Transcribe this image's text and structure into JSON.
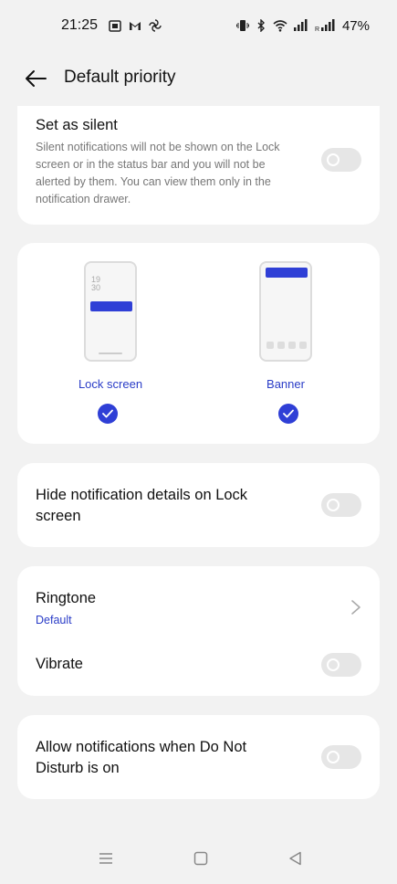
{
  "status_bar": {
    "time": "21:25",
    "battery": "47%",
    "left_icons": [
      "calendar-icon",
      "gmail-icon",
      "pinwheel-icon"
    ],
    "right_icons": [
      "vibrate-icon",
      "bluetooth-icon",
      "wifi-icon",
      "signal-icon",
      "signal-roaming-icon"
    ]
  },
  "header": {
    "title": "Default priority"
  },
  "silent": {
    "title": "Set as silent",
    "description": "Silent notifications will not be shown on the Lock screen or in the status bar and you will not be alerted by them. You can view them only in the notification drawer.",
    "enabled": false
  },
  "display_options": {
    "lock_screen": {
      "label": "Lock screen",
      "clock_line1": "19",
      "clock_line2": "30",
      "checked": true
    },
    "banner": {
      "label": "Banner",
      "checked": true
    }
  },
  "hide_details": {
    "title": "Hide notification details on Lock screen",
    "enabled": false
  },
  "sound": {
    "ringtone_title": "Ringtone",
    "ringtone_value": "Default",
    "vibrate_title": "Vibrate",
    "vibrate_enabled": false
  },
  "dnd": {
    "title": "Allow notifications when Do Not Disturb is on",
    "enabled": false
  },
  "colors": {
    "accent": "#2f3fd6",
    "toggle_off": "#e6e6e6",
    "background": "#f2f2f2"
  }
}
